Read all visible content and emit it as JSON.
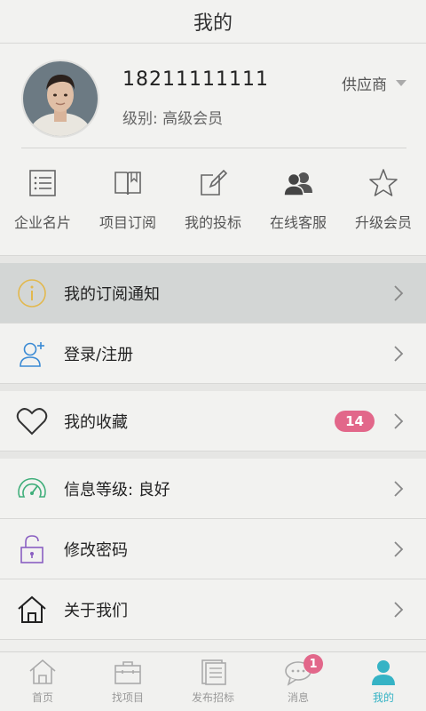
{
  "header": {
    "title": "我的"
  },
  "profile": {
    "phone": "18211111111",
    "level": "级别: 高级会员",
    "role": "供应商"
  },
  "quick": [
    {
      "label": "企业名片",
      "icon": "business-card-icon"
    },
    {
      "label": "项目订阅",
      "icon": "book-icon"
    },
    {
      "label": "我的投标",
      "icon": "edit-icon"
    },
    {
      "label": "在线客服",
      "icon": "users-icon"
    },
    {
      "label": "升级会员",
      "icon": "star-icon"
    }
  ],
  "menu": [
    {
      "label": "我的订阅通知",
      "icon": "info-icon"
    },
    {
      "label": "登录/注册",
      "icon": "add-user-icon"
    },
    {
      "label": "我的收藏",
      "icon": "heart-icon",
      "badge": "14"
    },
    {
      "label": "信息等级: 良好",
      "icon": "gauge-icon"
    },
    {
      "label": "修改密码",
      "icon": "lock-icon"
    },
    {
      "label": "关于我们",
      "icon": "home-icon"
    }
  ],
  "tabs": [
    {
      "label": "首页",
      "icon": "home-icon"
    },
    {
      "label": "找项目",
      "icon": "briefcase-icon"
    },
    {
      "label": "发布招标",
      "icon": "document-icon"
    },
    {
      "label": "消息",
      "icon": "message-icon",
      "badge": "1"
    },
    {
      "label": "我的",
      "icon": "user-icon"
    }
  ],
  "colors": {
    "accent": "#35b3c5",
    "badge": "#e2678a",
    "active_row": "#d3d6d5"
  }
}
